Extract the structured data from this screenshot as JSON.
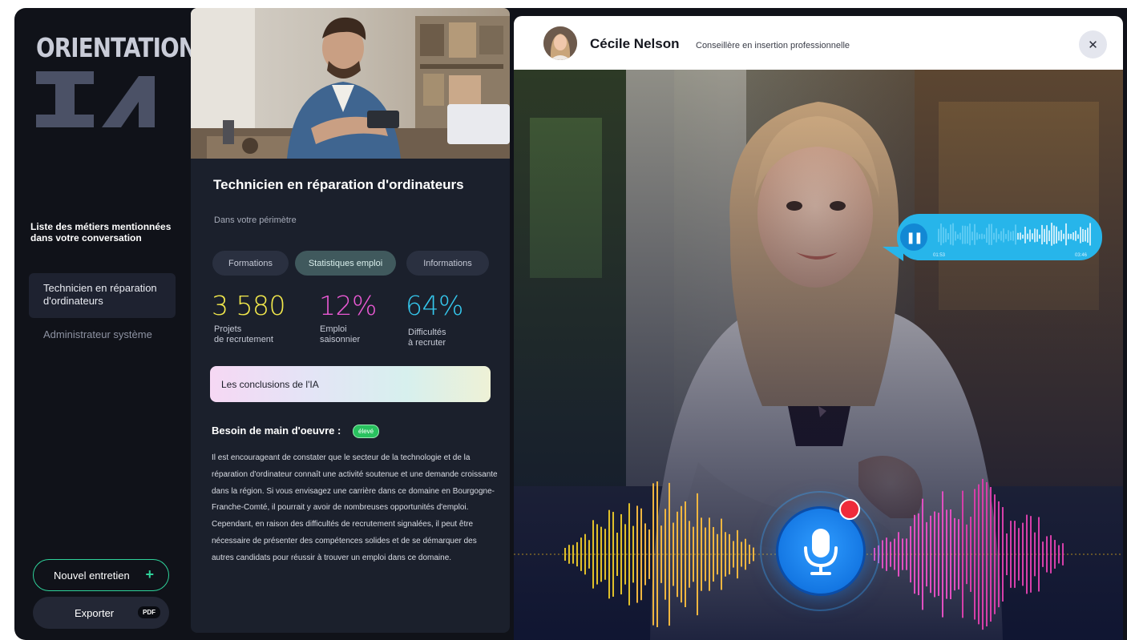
{
  "sidebar": {
    "brand_word": "ORIENTATION",
    "brand_mark": "IA",
    "mentions_title": "Liste des métiers mentionnées dans votre conversation",
    "jobs": [
      {
        "label": "Technicien en réparation d'ordinateurs",
        "active": true
      },
      {
        "label": "Administrateur système",
        "active": false
      }
    ],
    "new_interview": "Nouvel entretien",
    "export": "Exporter",
    "pdf_badge": "PDF"
  },
  "job_card": {
    "title": "Technicien en réparation d'ordinateurs",
    "subtitle": "Dans votre périmètre",
    "tabs": [
      {
        "label": "Formations",
        "active": false
      },
      {
        "label": "Statistiques emploi",
        "active": true
      },
      {
        "label": "Informations",
        "active": false
      }
    ],
    "stats": [
      {
        "value": "3 580",
        "label": "Projets\nde recrutement",
        "color": "#f4ea4c"
      },
      {
        "value": "12%",
        "label": "Emploi\nsaisonnier",
        "color": "#ea59d4"
      },
      {
        "value": "64%",
        "label": "Difficultés\nà recruter",
        "color": "#35c8ee"
      }
    ],
    "ai_conclusions_label": "Les conclusions de l'IA",
    "need_label": "Besoin de main d'oeuvre :",
    "need_level": "élevé",
    "body": "Il est encourageant de constater que le secteur de la technologie et de la réparation d'ordinateur connaît une activité soutenue et une demande croissante dans la région. Si vous envisagez une carrière dans ce domaine en Bourgogne-Franche-Comté, il pourrait y avoir de nombreuses opportunités d'emploi. Cependant, en raison des difficultés de recrutement signalées, il peut être nécessaire de présenter des compétences solides et de se démarquer des autres candidats pour réussir à trouver un emploi dans ce domaine."
  },
  "call": {
    "name": "Cécile Nelson",
    "role": "Conseillère en insertion professionnelle",
    "close_icon": "close-icon",
    "voice_message": {
      "elapsed": "01:53",
      "duration": "03:46",
      "icon": "pause-icon"
    },
    "mic_icon": "microphone-icon",
    "recording": true
  },
  "colors": {
    "accent_green": "#2fd29a",
    "stat_yellow": "#f4ea4c",
    "stat_pink": "#ea59d4",
    "stat_cyan": "#35c8ee",
    "mic_blue": "#1477e3",
    "rec_red": "#ee2b3a"
  }
}
